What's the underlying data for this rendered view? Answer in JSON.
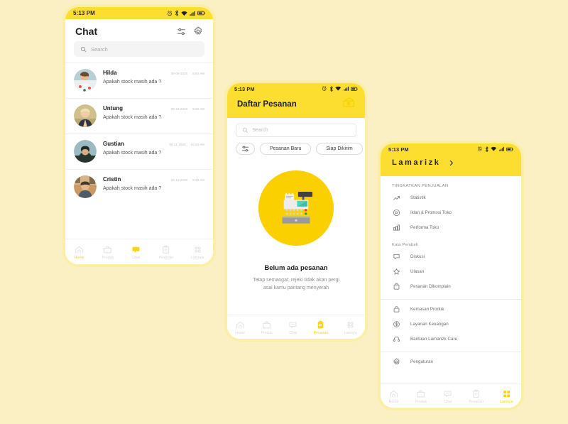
{
  "page": {
    "background_color": "#FBF0C4",
    "brand_yellow": "#FCDE31",
    "accent_yellow": "#FBD000",
    "frame_color": "#FBEFA7"
  },
  "phone1": {
    "status_bar": {
      "time": "5:13 PM",
      "icons": [
        "alarm-icon",
        "bluetooth-icon",
        "wifi-icon",
        "signal-icon",
        "battery-icon"
      ]
    },
    "header": {
      "title": "Chat",
      "icons": [
        "filter-icon",
        "gear-icon"
      ]
    },
    "search": {
      "placeholder": "Search",
      "icon": "search-icon"
    },
    "chats": [
      {
        "name": "Hilda",
        "message": "Apakah stock masih ada ?",
        "date": "08-09-2020",
        "time": "8:50 AM"
      },
      {
        "name": "Untung",
        "message": "Apakah stock masih ada ?",
        "date": "08-10-2020",
        "time": "9:30 AM"
      },
      {
        "name": "Gustian",
        "message": "Apakah stock masih ada ?",
        "date": "08-11-2020",
        "time": "10:20 AM"
      },
      {
        "name": "Cristin",
        "message": "Apakah stock masih ada ?",
        "date": "08-12-2020",
        "time": "6:49 AM"
      }
    ],
    "bottom_nav": {
      "active": "Home",
      "items": [
        {
          "label": "Home",
          "icon": "home-icon"
        },
        {
          "label": "Produk",
          "icon": "briefcase-icon"
        },
        {
          "label": "Chat",
          "icon": "chat-bubble-icon"
        },
        {
          "label": "Pesanan",
          "icon": "clipboard-icon"
        },
        {
          "label": "Lainnya",
          "icon": "grid-icon"
        }
      ]
    }
  },
  "phone2": {
    "status_bar": {
      "time": "5:13 PM",
      "icons": [
        "alarm-icon",
        "bluetooth-icon",
        "wifi-icon",
        "signal-icon",
        "battery-icon"
      ]
    },
    "header": {
      "title": "Daftar Pesanan",
      "icon": "cash-register-icon"
    },
    "search": {
      "placeholder": "Search",
      "icon": "search-icon"
    },
    "filters": [
      {
        "label": "",
        "icon": "filter-icon"
      },
      {
        "label": "Pesanan Baru"
      },
      {
        "label": "Siap Dikirim"
      }
    ],
    "empty_state": {
      "illustration": "cash-register-illustration",
      "title": "Belum ada pesanan",
      "subtitle_line1": "Tetap semangat, rejeki tidak akan pergi",
      "subtitle_line2": "asal kamu pantang menyerah"
    },
    "bottom_nav": {
      "active": "Pesanan",
      "items": [
        {
          "label": "Home",
          "icon": "home-icon"
        },
        {
          "label": "Produk",
          "icon": "briefcase-icon"
        },
        {
          "label": "Chat",
          "icon": "chat-bubble-icon"
        },
        {
          "label": "Pesanan",
          "icon": "clipboard-icon"
        },
        {
          "label": "Lainnya",
          "icon": "grid-icon"
        }
      ]
    }
  },
  "phone3": {
    "status_bar": {
      "time": "5:13 PM",
      "icons": [
        "alarm-icon",
        "bluetooth-icon",
        "wifi-icon",
        "signal-icon",
        "battery-icon"
      ]
    },
    "header": {
      "shop_name": "Lamarizk",
      "chevron": "chevron-right-icon"
    },
    "sections": [
      {
        "title": "TINGKATKAN PENJUALAN",
        "items": [
          {
            "label": "Statistik",
            "icon": "trending-up-icon"
          },
          {
            "label": "Iklan & Promosi Toko",
            "icon": "megaphone-icon"
          },
          {
            "label": "Performa Toko",
            "icon": "bar-chart-icon"
          }
        ]
      },
      {
        "title": "Kata Pembeli",
        "items": [
          {
            "label": "Diskusi",
            "icon": "chat-bubble-icon"
          },
          {
            "label": "Ulasan",
            "icon": "star-icon"
          },
          {
            "label": "Pesanan Dikomplain",
            "icon": "box-icon"
          }
        ]
      },
      {
        "title": "",
        "items": [
          {
            "label": "Kemasan Produk",
            "icon": "bag-icon"
          },
          {
            "label": "Layanan Keuangan",
            "icon": "dollar-circle-icon"
          },
          {
            "label": "Bantuan Lamarizk Care",
            "icon": "headset-icon"
          }
        ]
      },
      {
        "title": "",
        "items": [
          {
            "label": "Pengaturan",
            "icon": "gear-icon"
          }
        ]
      }
    ],
    "bottom_nav": {
      "active": "Lainnya",
      "items": [
        {
          "label": "Home",
          "icon": "home-icon"
        },
        {
          "label": "Produk",
          "icon": "briefcase-icon"
        },
        {
          "label": "Chat",
          "icon": "chat-bubble-icon"
        },
        {
          "label": "Pesanan",
          "icon": "clipboard-icon"
        },
        {
          "label": "Lainnya",
          "icon": "grid-icon"
        }
      ]
    }
  }
}
